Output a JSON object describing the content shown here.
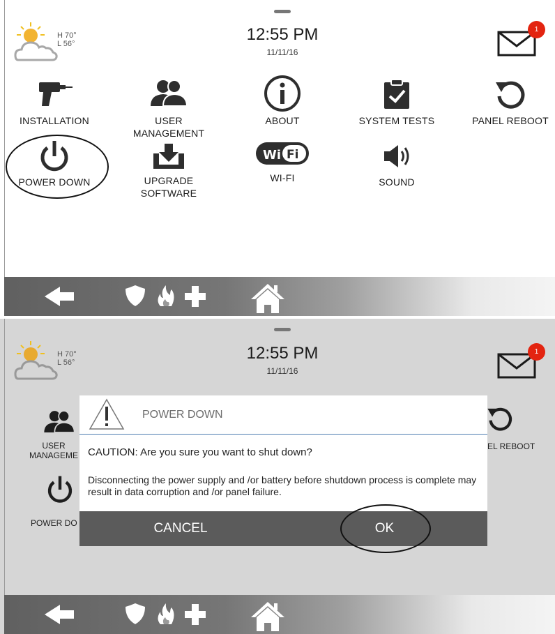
{
  "status": {
    "time": "12:55 PM",
    "date": "11/11/16",
    "weather": {
      "high": "H 70°",
      "low": "L 56°",
      "icon": "partly-cloudy-icon"
    },
    "messages": {
      "count": "1",
      "icon": "envelope-icon"
    }
  },
  "menu": {
    "items": [
      {
        "id": "installation",
        "label": "INSTALLATION",
        "icon": "drill-icon"
      },
      {
        "id": "user-management",
        "label": "USER MANAGEMENT",
        "icon": "users-icon"
      },
      {
        "id": "about",
        "label": "ABOUT",
        "icon": "info-icon"
      },
      {
        "id": "system-tests",
        "label": "SYSTEM TESTS",
        "icon": "clipboard-check-icon"
      },
      {
        "id": "panel-reboot",
        "label": "PANEL REBOOT",
        "icon": "reboot-icon"
      },
      {
        "id": "power-down",
        "label": "POWER DOWN",
        "icon": "power-icon"
      },
      {
        "id": "upgrade-software",
        "label": "UPGRADE SOFTWARE",
        "icon": "download-tray-icon"
      },
      {
        "id": "wifi",
        "label": "WI-FI",
        "icon": "wifi-logo-icon"
      },
      {
        "id": "sound",
        "label": "SOUND",
        "icon": "speaker-icon"
      }
    ]
  },
  "obscured": {
    "user_management": "USER MANAGEME",
    "panel_reboot": "EL REBOOT",
    "power_down": "POWER DO"
  },
  "dialog": {
    "title": "POWER DOWN",
    "caution": "CAUTION: Are you sure you want to shut down?",
    "body": "Disconnecting the power supply and /or battery before shutdown process is complete may result in data corruption and /or panel failure.",
    "cancel_label": "CANCEL",
    "ok_label": "OK"
  },
  "navbar": {
    "buttons": [
      "back-arrow-icon",
      "security-shield-icon",
      "fire-icon",
      "medical-cross-icon",
      "home-icon"
    ]
  },
  "colors": {
    "badge": "#e32410",
    "dialog_button_bar": "#5b5b5b",
    "dialog_divider": "#4d7bb0",
    "dimmed_background": "#d6d6d6"
  }
}
